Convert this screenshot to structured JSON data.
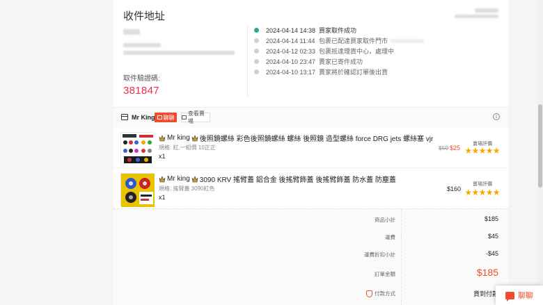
{
  "address": {
    "title": "收件地址",
    "otp_label": "取件驗證碼:",
    "otp_code": "381847"
  },
  "timeline": [
    {
      "time": "2024-04-14 14:38",
      "desc": "買家取件成功",
      "active": true
    },
    {
      "time": "2024-04-14 11:44",
      "desc": "包裹已配達買家取件門市",
      "active": false
    },
    {
      "time": "2024-04-12 02:33",
      "desc": "包裹抵達理貨中心，處理中",
      "active": false
    },
    {
      "time": "2024-04-10 23:47",
      "desc": "賣家已寄件成功",
      "active": false
    },
    {
      "time": "2024-04-10 13:17",
      "desc": "賣家將於確認訂單後出貨",
      "active": false
    }
  ],
  "shop": {
    "name": "Mr King",
    "chat_label": "聊聊",
    "view_label": "查看賣場"
  },
  "items": [
    {
      "prefix": "Mr king",
      "name": "後照鏡螺絲 彩色後照鏡螺絲 螺絲 後照鏡 造型螺絲 force DRG jets 螺絲塞 vjr",
      "variation": "規格: 紅,一組價 10正正",
      "qty": "x1",
      "price_original": "$50",
      "price": "$25",
      "rate_label": "賣場評價",
      "stars": 5
    },
    {
      "prefix": "Mr king",
      "name": "3090 KRV 搖臂蓋 鋁合金 後搖臂飾蓋 後搖臂飾蓋 防水蓋 防塵蓋",
      "variation": "規格: 搖臂蓋 3090紅色",
      "qty": "x1",
      "price_original": "",
      "price": "$160",
      "rate_label": "賣場評價",
      "stars": 5
    }
  ],
  "summary": {
    "subtotal_label": "商品小計",
    "subtotal": "$185",
    "shipping_label": "運費",
    "shipping": "$45",
    "shipping_discount_label": "運費折扣小計",
    "shipping_discount": "-$45",
    "total_label": "訂單金額",
    "total": "$185",
    "payment_label": "付款方式",
    "payment": "貨到付款"
  },
  "float_chat": {
    "label": "聊聊"
  },
  "colors": {
    "accent": "#ee4d2d",
    "otp": "#ee2c4a",
    "timeline_active": "#26aa99",
    "star": "#f6a700"
  }
}
